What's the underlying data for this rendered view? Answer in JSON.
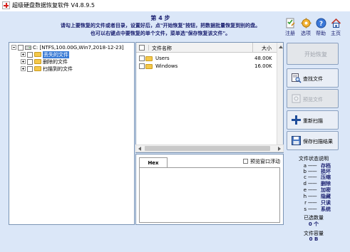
{
  "window": {
    "title": "超级硬盘数据恢复软件 V4.8.9.5"
  },
  "header": {
    "step": "第 4 步",
    "line1": "请勾上要恢复的文件或者目录，设置好后，点\"开始恢复\"按钮，把数据批量恢复到别的盘。",
    "line2": "也可以右键点中要恢复的单个文件，菜单选\"保存恢复该文件\"。"
  },
  "toolbar": [
    {
      "label": "注册",
      "icon": "register-icon"
    },
    {
      "label": "选项",
      "icon": "options-gear-icon"
    },
    {
      "label": "帮助",
      "icon": "help-icon"
    },
    {
      "label": "主页",
      "icon": "home-icon"
    }
  ],
  "tree": {
    "root": "C: [NTFS,100.00G,Win7,2018-12-23]",
    "children": [
      "丢失的文件",
      "删除的文件",
      "扫描到的文件"
    ]
  },
  "filelist": {
    "columns": [
      "文件名称",
      "大小"
    ],
    "rows": [
      {
        "name": "Users",
        "size": "48.00K"
      },
      {
        "name": "Windows",
        "size": "16.00K"
      }
    ]
  },
  "hex": {
    "tab": "Hex",
    "float_label": "预览窗口浮动"
  },
  "actions": {
    "start": "开始恢复",
    "find": "查找文件",
    "preview": "预览文件",
    "rescan": "重新扫描",
    "save_scan": "保存扫描结果"
  },
  "legend": {
    "title": "文件状态说明",
    "items": [
      {
        "key": "a",
        "dash": "------",
        "value": "存档"
      },
      {
        "key": "b",
        "dash": "------",
        "value": "损坏"
      },
      {
        "key": "c",
        "dash": "------",
        "value": "压缩"
      },
      {
        "key": "d",
        "dash": "------",
        "value": "删除"
      },
      {
        "key": "e",
        "dash": "------",
        "value": "加密"
      },
      {
        "key": "h",
        "dash": "------",
        "value": "隐藏"
      },
      {
        "key": "r",
        "dash": "------",
        "value": "只读"
      },
      {
        "key": "s",
        "dash": "------",
        "value": "系统"
      }
    ],
    "selected_label": "已选数量",
    "selected_value": "0 个",
    "size_label": "文件容量",
    "size_value": "0 B"
  },
  "colors": {
    "accent": "#1a1f70",
    "selection": "#3a7bd5",
    "window_bg": "#dbe7f8"
  }
}
